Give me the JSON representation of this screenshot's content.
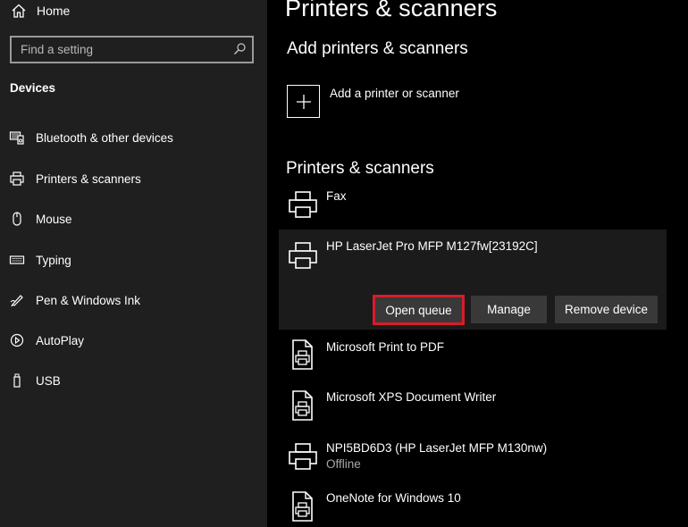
{
  "sidebar": {
    "home_label": "Home",
    "search_placeholder": "Find a setting",
    "section_title": "Devices",
    "items": [
      {
        "label": "Bluetooth & other devices",
        "icon": "bluetooth-devices-icon"
      },
      {
        "label": "Printers & scanners",
        "icon": "printer-icon"
      },
      {
        "label": "Mouse",
        "icon": "mouse-icon"
      },
      {
        "label": "Typing",
        "icon": "keyboard-icon"
      },
      {
        "label": "Pen & Windows Ink",
        "icon": "pen-icon"
      },
      {
        "label": "AutoPlay",
        "icon": "autoplay-icon"
      },
      {
        "label": "USB",
        "icon": "usb-icon"
      }
    ]
  },
  "main": {
    "page_title": "Printers & scanners",
    "add_section_title": "Add printers & scanners",
    "add_label": "Add a printer or scanner",
    "list_title": "Printers & scanners",
    "printers": [
      {
        "name": "Fax",
        "status": "",
        "icon": "printer-icon"
      },
      {
        "name": "HP LaserJet Pro MFP M127fw[23192C]",
        "status": "",
        "icon": "printer-icon"
      },
      {
        "name": "Microsoft Print to PDF",
        "status": "",
        "icon": "document-printer-icon"
      },
      {
        "name": "Microsoft XPS Document Writer",
        "status": "",
        "icon": "document-printer-icon"
      },
      {
        "name": "NPI5BD6D3 (HP LaserJet MFP M130nw)",
        "status": "Offline",
        "icon": "printer-icon"
      },
      {
        "name": "OneNote for Windows 10",
        "status": "",
        "icon": "document-printer-icon"
      }
    ],
    "actions": {
      "open_queue": "Open queue",
      "manage": "Manage",
      "remove": "Remove device"
    }
  },
  "colors": {
    "sidebar_bg": "#1f1f1f",
    "main_bg": "#000000",
    "button_bg": "#393939",
    "highlight_border": "#d91b2a",
    "selected_row_bg": "#1b1b1b"
  }
}
